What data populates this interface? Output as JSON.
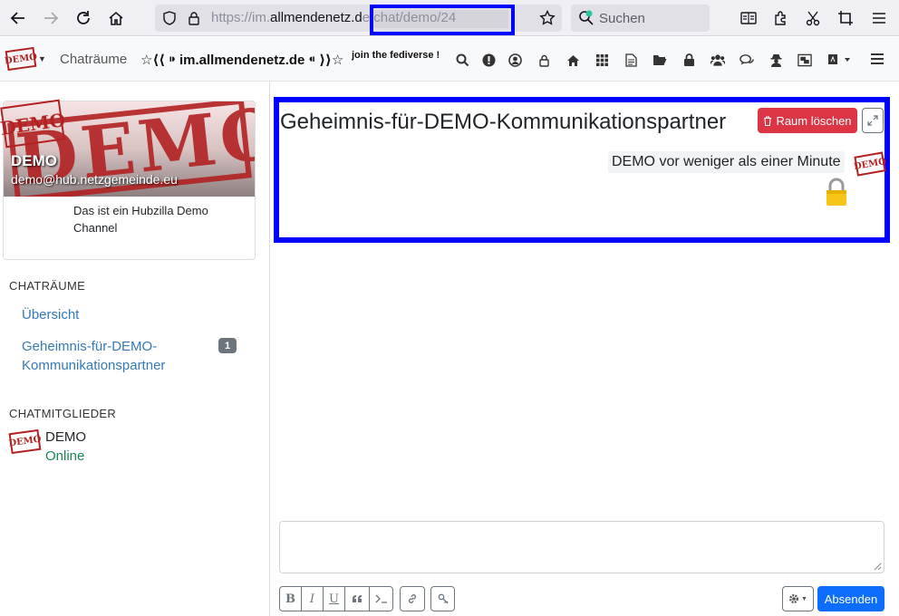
{
  "browser": {
    "url_prefix": "https://im.",
    "url_domain": "allmendenetz.d",
    "url_suffix": "e/chat/demo/24",
    "search_placeholder": "Suchen"
  },
  "nav": {
    "chat_label": "Chaträume",
    "site_name": "☆⟨⟨ ⁍ im.allmendenetz.de ⁌ ⟩⟩☆",
    "fediverse": "join the fediverse !",
    "logo_text": "DEMO"
  },
  "profile": {
    "banner_text": "DEMO",
    "name": "DEMO",
    "address": "demo@hub.netzgemeinde.eu",
    "avatar_text": "DEMO",
    "description": "Das ist ein Hubzilla Demo Channel"
  },
  "sidebar": {
    "chatrooms_title": "CHATRÄUME",
    "overview": "Übersicht",
    "room_link": "Geheimnis-für-DEMO-Kommunikationspartner",
    "room_badge": "1",
    "members_title": "CHATMITGLIEDER",
    "member_name": "DEMO",
    "member_status": "Online",
    "member_avatar_text": "DEMO"
  },
  "chat": {
    "title": "Geheimnis-für-DEMO-Kommunikationspartner",
    "delete_label": "Raum löschen",
    "message_meta": "DEMO vor weniger als einer Minute",
    "message_avatar_text": "DEMO",
    "send_label": "Absenden"
  },
  "colors": {
    "highlight": "#0000ff",
    "danger": "#dc3545",
    "primary": "#0d6efd",
    "link": "#337ab7",
    "online": "#198754"
  }
}
